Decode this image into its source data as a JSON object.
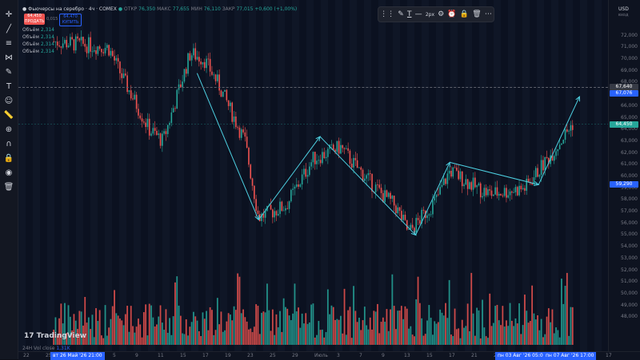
{
  "window": {
    "symbol_title": "Фьючерсы на серебро · 4ч · COMEX",
    "ohlc": {
      "o_label": "ОТКР",
      "o": "76,350",
      "h_label": "МАКС",
      "h": "77,655",
      "l_label": "МИН",
      "l": "76,110",
      "c_label": "ЗАКР",
      "c": "77,015",
      "change": "+0,600 (+1,00%)"
    },
    "sell_pill": {
      "price": "64,450",
      "label": "ПРОДАТЬ"
    },
    "spread": "0,015",
    "buy_pill": {
      "price": "64,470",
      "label": "КУПИТЬ"
    },
    "indicators": [
      {
        "label": "Объём",
        "value": "2,314"
      },
      {
        "label": "Объём",
        "value": "2,314"
      },
      {
        "label": "Объём",
        "value": "2,314"
      },
      {
        "label": "Объём",
        "value": "2,314"
      }
    ],
    "currency": "USD",
    "currency_sub": "вход",
    "logo_text": "TradingView",
    "volume_readout": {
      "label": "24H Vol close",
      "value": "1,31K"
    }
  },
  "drawing_toolbar": {
    "width_label": "2px"
  },
  "price_axis": {
    "ticks": [
      "72,000",
      "71,000",
      "70,000",
      "69,000",
      "68,000",
      "66,000",
      "65,000",
      "64,000",
      "63,000",
      "62,000",
      "61,000",
      "60,000",
      "59,000",
      "58,000",
      "57,000",
      "56,000",
      "55,000",
      "54,000",
      "53,000",
      "52,000",
      "51,000",
      "50,000",
      "49,000",
      "48,000"
    ],
    "labels": [
      {
        "text": "67,640",
        "bg": "#363a45"
      },
      {
        "text": "67,076",
        "bg": "#2962ff"
      },
      {
        "text": "64,450",
        "bg": "#26a69a"
      },
      {
        "text": "59,290",
        "bg": "#2962ff"
      }
    ]
  },
  "time_axis": {
    "ticks": [
      "22",
      "25",
      "Июн",
      "3",
      "5",
      "9",
      "11",
      "15",
      "17",
      "19",
      "23",
      "25",
      "29",
      "Июль",
      "3",
      "7",
      "9",
      "13",
      "15",
      "17",
      "21",
      "23",
      "27",
      "29",
      "Авг",
      "13",
      "17"
    ],
    "badges": [
      {
        "text": "вт 26 Май '26   21:00"
      },
      {
        "text": "пн 03 Авг '26   05:00"
      },
      {
        "text": "пн 07 Авг '26   17:00"
      }
    ]
  },
  "chart_data": {
    "type": "candlestick",
    "y_unit": "USD",
    "ylim": [
      47,
      73
    ],
    "x_range": [
      "2026-05-22",
      "2026-08-14"
    ],
    "approx_close_path": [
      {
        "date": "2026-05-26",
        "value": 71.5
      },
      {
        "date": "2026-06-03",
        "value": 71.0
      },
      {
        "date": "2026-06-05",
        "value": 68.5
      },
      {
        "date": "2026-06-09",
        "value": 64.0
      },
      {
        "date": "2026-06-11",
        "value": 63.0
      },
      {
        "date": "2026-06-15",
        "value": 70.5
      },
      {
        "date": "2026-06-17",
        "value": 70.0
      },
      {
        "date": "2026-06-19",
        "value": 68.0
      },
      {
        "date": "2026-06-23",
        "value": 63.0
      },
      {
        "date": "2026-06-25",
        "value": 56.5
      },
      {
        "date": "2026-06-29",
        "value": 57.5
      },
      {
        "date": "2026-07-03",
        "value": 61.5
      },
      {
        "date": "2026-07-07",
        "value": 62.5
      },
      {
        "date": "2026-07-09",
        "value": 61.0
      },
      {
        "date": "2026-07-13",
        "value": 58.5
      },
      {
        "date": "2026-07-15",
        "value": 57.5
      },
      {
        "date": "2026-07-17",
        "value": 55.2
      },
      {
        "date": "2026-07-21",
        "value": 58.0
      },
      {
        "date": "2026-07-23",
        "value": 60.5
      },
      {
        "date": "2026-07-27",
        "value": 59.0
      },
      {
        "date": "2026-07-29",
        "value": 58.5
      },
      {
        "date": "2026-08-03",
        "value": 59.0
      },
      {
        "date": "2026-08-07",
        "value": 62.0
      },
      {
        "date": "2026-08-10",
        "value": 64.5
      }
    ],
    "zigzag_drawing": [
      {
        "date": "2026-06-16",
        "value": 68.8
      },
      {
        "date": "2026-06-25",
        "value": 56.3
      },
      {
        "date": "2026-07-04",
        "value": 63.4
      },
      {
        "date": "2026-07-18",
        "value": 55.0
      },
      {
        "date": "2026-07-23",
        "value": 61.2
      },
      {
        "date": "2026-08-05",
        "value": 59.3
      },
      {
        "date": "2026-08-11",
        "value": 66.8
      }
    ],
    "colors": {
      "up": "#26a69a",
      "down": "#ef5350",
      "drawing": "#4dd0e1"
    }
  }
}
